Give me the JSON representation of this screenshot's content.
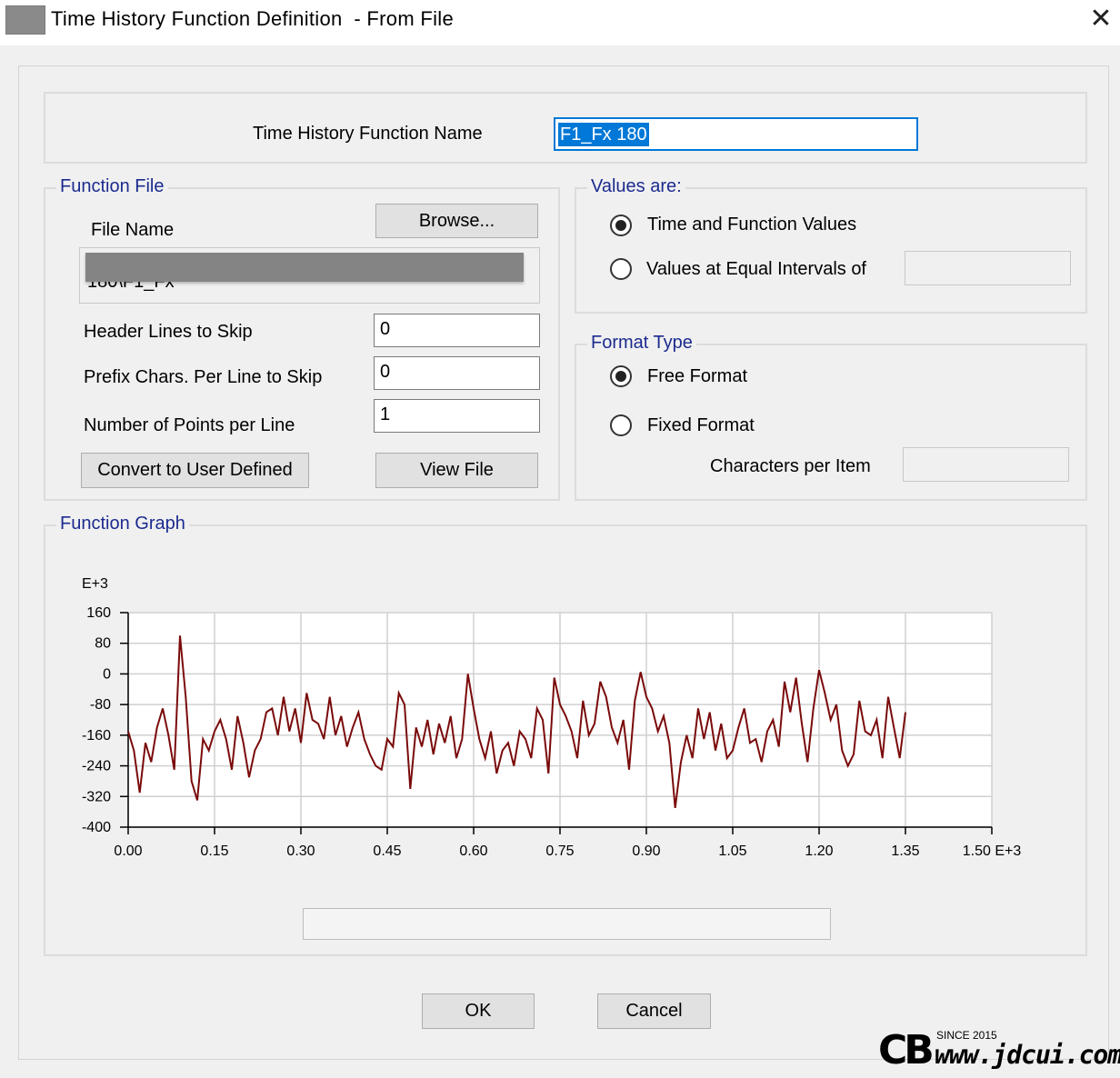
{
  "window": {
    "title": "Time History Function Definition  - From File",
    "close_glyph": "✕"
  },
  "name_group": {
    "label": "Time History Function Name",
    "value": "F1_Fx 180"
  },
  "function_file": {
    "legend": "Function File",
    "file_name_label": "File Name",
    "browse_label": "Browse...",
    "file_path_visible": "180\\F1_Fx",
    "header_lines_label": "Header Lines to Skip",
    "header_lines_value": "0",
    "prefix_chars_label": "Prefix Chars. Per Line to Skip",
    "prefix_chars_value": "0",
    "points_per_line_label": "Number of Points per Line",
    "points_per_line_value": "1",
    "convert_label": "Convert to User Defined",
    "view_file_label": "View File"
  },
  "values_are": {
    "legend": "Values are:",
    "option_time_function": "Time and Function Values",
    "option_equal_intervals": "Values at Equal Intervals of",
    "selected": "time_function",
    "interval_value": ""
  },
  "format_type": {
    "legend": "Format Type",
    "option_free": "Free Format",
    "option_fixed": "Fixed Format",
    "selected": "free",
    "chars_per_item_label": "Characters per Item",
    "chars_per_item_value": ""
  },
  "function_graph": {
    "legend": "Function Graph"
  },
  "chart_data": {
    "type": "line",
    "y_exponent_label": "E+3",
    "x_exponent_label": "E+3",
    "xlim": [
      0,
      1.5
    ],
    "ylim": [
      -400,
      160
    ],
    "x_ticks": [
      "0.00",
      "0.15",
      "0.30",
      "0.45",
      "0.60",
      "0.75",
      "0.90",
      "1.05",
      "1.20",
      "1.35",
      "1.50"
    ],
    "y_ticks": [
      "160",
      "80",
      "0",
      "-80",
      "-160",
      "-240",
      "-320",
      "-400"
    ],
    "grid": true,
    "line_color": "#7a0a0a",
    "series": [
      {
        "x": [
          0.0,
          0.01,
          0.02,
          0.03,
          0.04,
          0.05,
          0.06,
          0.07,
          0.08,
          0.09,
          0.1,
          0.11,
          0.12,
          0.13,
          0.14,
          0.15,
          0.16,
          0.17,
          0.18,
          0.19,
          0.2,
          0.21,
          0.22,
          0.23,
          0.24,
          0.25,
          0.26,
          0.27,
          0.28,
          0.29,
          0.3,
          0.31,
          0.32,
          0.33,
          0.34,
          0.35,
          0.36,
          0.37,
          0.38,
          0.39,
          0.4,
          0.41,
          0.42,
          0.43,
          0.44,
          0.45,
          0.46,
          0.47,
          0.48,
          0.49,
          0.5,
          0.51,
          0.52,
          0.53,
          0.54,
          0.55,
          0.56,
          0.57,
          0.58,
          0.59,
          0.6,
          0.61,
          0.62,
          0.63,
          0.64,
          0.65,
          0.66,
          0.67,
          0.68,
          0.69,
          0.7,
          0.71,
          0.72,
          0.73,
          0.74,
          0.75,
          0.76,
          0.77,
          0.78,
          0.79,
          0.8,
          0.81,
          0.82,
          0.83,
          0.84,
          0.85,
          0.86,
          0.87,
          0.88,
          0.89,
          0.9,
          0.91,
          0.92,
          0.93,
          0.94,
          0.95,
          0.96,
          0.97,
          0.98,
          0.99,
          1.0,
          1.01,
          1.02,
          1.03,
          1.04,
          1.05,
          1.06,
          1.07,
          1.08,
          1.09,
          1.1,
          1.11,
          1.12,
          1.13,
          1.14,
          1.15,
          1.16,
          1.17,
          1.18,
          1.19,
          1.2,
          1.21,
          1.22,
          1.23,
          1.24,
          1.25,
          1.26,
          1.27,
          1.28,
          1.29,
          1.3,
          1.31,
          1.32,
          1.33,
          1.34,
          1.35
        ],
        "y": [
          -150,
          -200,
          -310,
          -180,
          -230,
          -140,
          -90,
          -160,
          -250,
          100,
          -60,
          -280,
          -330,
          -170,
          -200,
          -150,
          -120,
          -170,
          -250,
          -110,
          -180,
          -270,
          -200,
          -170,
          -100,
          -90,
          -160,
          -60,
          -150,
          -90,
          -180,
          -50,
          -120,
          -130,
          -170,
          -60,
          -160,
          -110,
          -190,
          -140,
          -100,
          -170,
          -210,
          -240,
          -250,
          -170,
          -190,
          -50,
          -80,
          -300,
          -140,
          -190,
          -120,
          -210,
          -130,
          -180,
          -110,
          -220,
          -170,
          0,
          -90,
          -170,
          -220,
          -150,
          -260,
          -200,
          -180,
          -240,
          -150,
          -170,
          -220,
          -90,
          -120,
          -260,
          -10,
          -80,
          -110,
          -150,
          -220,
          -70,
          -160,
          -130,
          -20,
          -60,
          -140,
          -180,
          -120,
          -250,
          -70,
          5,
          -60,
          -90,
          -150,
          -110,
          -180,
          -350,
          -230,
          -160,
          -220,
          -90,
          -170,
          -100,
          -200,
          -130,
          -220,
          -200,
          -140,
          -90,
          -180,
          -170,
          -230,
          -150,
          -120,
          -190,
          -20,
          -100,
          -10,
          -130,
          -230,
          -90,
          10,
          -50,
          -120,
          -80,
          -200,
          -240,
          -210,
          -70,
          -150,
          -160,
          -120,
          -220,
          -60,
          -140,
          -220,
          -100
        ]
      }
    ]
  },
  "buttons": {
    "ok_label": "OK",
    "cancel_label": "Cancel"
  },
  "watermark": {
    "since": "SINCE 2015",
    "url": "www.jdcui.com",
    "logo": "CB"
  }
}
